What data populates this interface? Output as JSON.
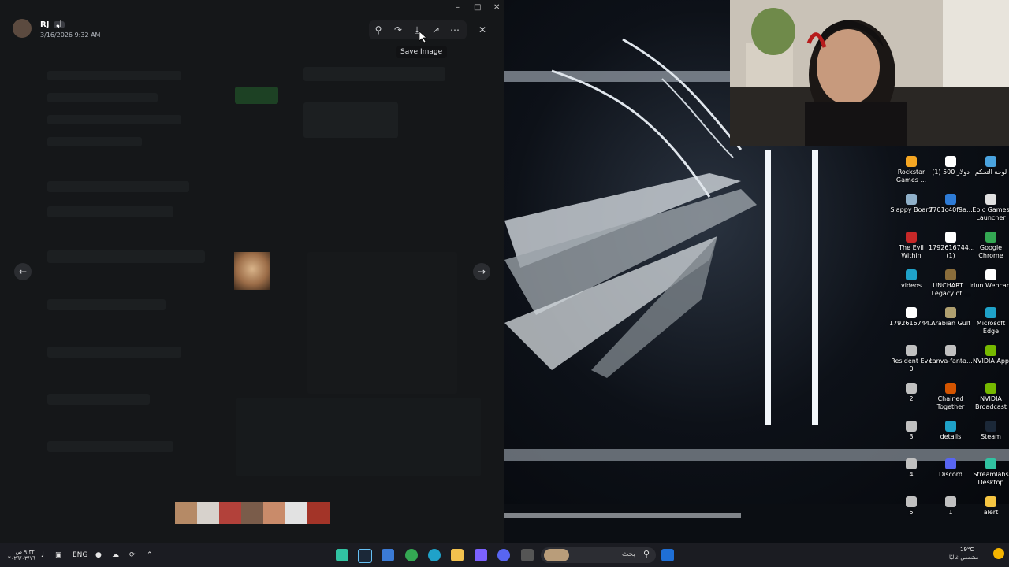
{
  "viewer": {
    "user_name": "RJ",
    "user_badge": "أو",
    "timestamp": "3/16/2026 9:32 AM",
    "tooltip": "Save Image",
    "toolbar_icons": [
      "zoom-in-icon",
      "forward-icon",
      "download-icon",
      "open-external-icon",
      "more-icon"
    ]
  },
  "desktop": {
    "icons": [
      {
        "name": "rockstar-games-icon",
        "label": "Rockstar Games ...",
        "color": "#f5a623"
      },
      {
        "name": "file-icon",
        "label": "(1) دولار 500",
        "color": "#ffffff"
      },
      {
        "name": "control-panel-icon",
        "label": "لوحة التحكم",
        "color": "#4aa3df"
      },
      {
        "name": "slappy-board-icon",
        "label": "Slappy Board",
        "color": "#8fb0c9"
      },
      {
        "name": "file2-icon",
        "label": "7701c40f9a...",
        "color": "#2e7bd6"
      },
      {
        "name": "epic-games-icon",
        "label": "Epic Games Launcher",
        "color": "#e0e0e0"
      },
      {
        "name": "evil-within-icon",
        "label": "The Evil Within",
        "color": "#c62828"
      },
      {
        "name": "file3-icon",
        "label": "1792616744... (1)",
        "color": "#ffffff"
      },
      {
        "name": "chrome-icon",
        "label": "Google Chrome",
        "color": "#34a853"
      },
      {
        "name": "edge-videos-icon",
        "label": "videos",
        "color": "#1fa2c9"
      },
      {
        "name": "uncharted-icon",
        "label": "UNCHART... Legacy of ...",
        "color": "#8a6d3b"
      },
      {
        "name": "iriun-icon",
        "label": "Iriun Webcam",
        "color": "#ffffff"
      },
      {
        "name": "file4-icon",
        "label": "1792616744...",
        "color": "#ffffff"
      },
      {
        "name": "arabian-gulf-icon",
        "label": "Arabian Gulf",
        "color": "#b0a070"
      },
      {
        "name": "edge-icon",
        "label": "Microsoft Edge",
        "color": "#1fa2c9"
      },
      {
        "name": "resident-evil-icon",
        "label": "Resident Evil 0",
        "color": "#c0c0c0"
      },
      {
        "name": "canva-icon",
        "label": "canva-fanta...",
        "color": "#c0c0c0"
      },
      {
        "name": "nvidia-app-icon",
        "label": "NVIDIA App",
        "color": "#76b900"
      },
      {
        "name": "shortcut-2-icon",
        "label": "2",
        "color": "#c0c0c0"
      },
      {
        "name": "chained-together-icon",
        "label": "Chained Together",
        "color": "#d35400"
      },
      {
        "name": "nvidia-broadcast-icon",
        "label": "NVIDIA Broadcast",
        "color": "#76b900"
      },
      {
        "name": "shortcut-3-icon",
        "label": "3",
        "color": "#c0c0c0"
      },
      {
        "name": "details-icon",
        "label": "details",
        "color": "#1fa2c9"
      },
      {
        "name": "steam-icon",
        "label": "Steam",
        "color": "#1b2838"
      },
      {
        "name": "shortcut-4-icon",
        "label": "4",
        "color": "#c0c0c0"
      },
      {
        "name": "discord-icon",
        "label": "Discord",
        "color": "#5865f2"
      },
      {
        "name": "streamlabs-icon",
        "label": "Streamlabs Desktop",
        "color": "#31c3a2"
      },
      {
        "name": "shortcut-5-icon",
        "label": "5",
        "color": "#c0c0c0"
      },
      {
        "name": "shortcut-1-icon",
        "label": "1",
        "color": "#c0c0c0"
      },
      {
        "name": "alert-icon",
        "label": "alert",
        "color": "#f5c542"
      }
    ]
  },
  "taskbar": {
    "time": "٩:٣٢ ص",
    "date": "٢٠٢٦/٠٣/١٦",
    "language": "ENG",
    "search_placeholder": "بحث",
    "weather_temp": "19°C",
    "weather_text": "مشمس غالبًا"
  }
}
